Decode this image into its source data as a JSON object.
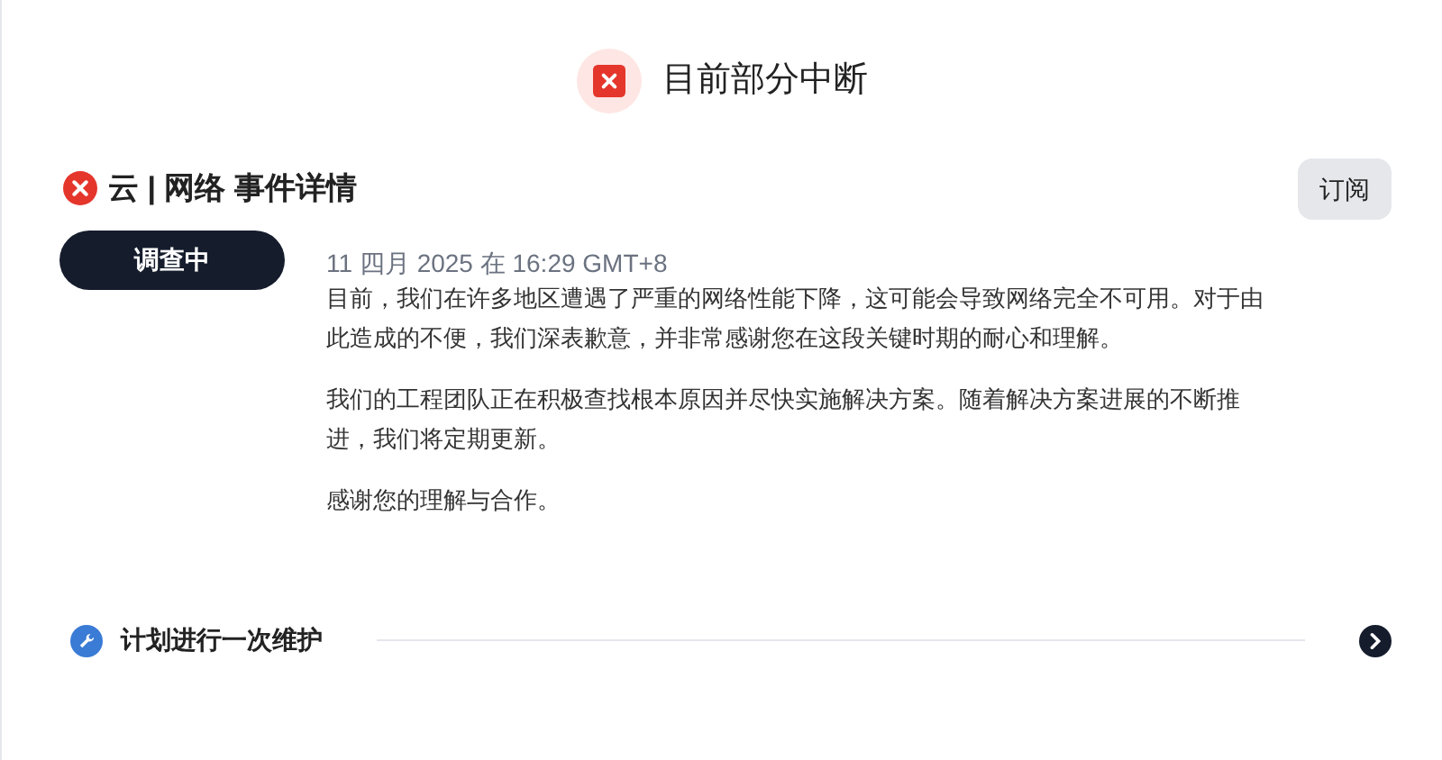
{
  "status": {
    "kind": "outage",
    "label": "目前部分中断"
  },
  "incident": {
    "kind": "outage",
    "title": "云 | 网络 事件详情",
    "subscribe": "订阅",
    "badge": "调查中",
    "time": "11 四月 2025 在 16:29 GMT+8",
    "paragraphs": [
      "目前，我们在许多地区遭遇了严重的网络性能下降，这可能会导致网络完全不可用。对于由此造成的不便，我们深表歉意，并非常感谢您在这段关键时期的耐心和理解。",
      "我们的工程团队正在积极查找根本原因并尽快实施解决方案。随着解决方案进展的不断推进，我们将定期更新。",
      "感谢您的理解与合作。"
    ]
  },
  "maintenance": {
    "kind": "maintenance",
    "title": "计划进行一次维护",
    "expanded": false
  }
}
